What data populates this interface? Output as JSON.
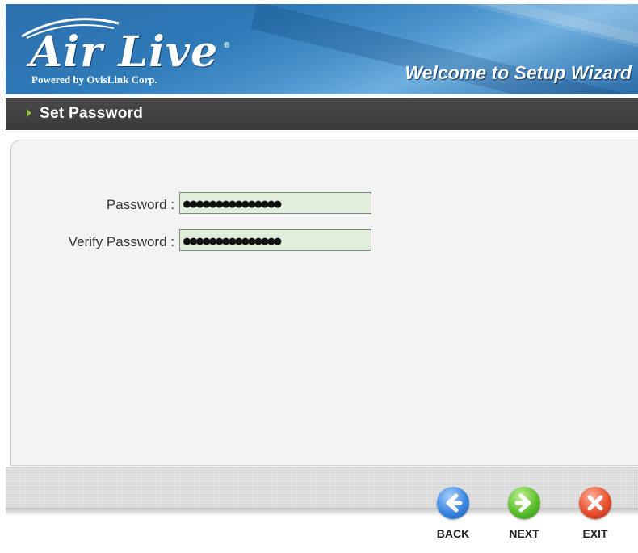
{
  "header": {
    "logo_text": "Air Live",
    "logo_registered": "®",
    "logo_subtitle": "Powered by OvisLink Corp.",
    "wizard_title": "Welcome to Setup Wizard"
  },
  "section": {
    "title": "Set Password"
  },
  "form": {
    "password_label": "Password :",
    "password_value": "●●●●●●●●●●●●●●●",
    "verify_label": "Verify Password :",
    "verify_value": "●●●●●●●●●●●●●●●"
  },
  "nav": {
    "back_label": "BACK",
    "next_label": "NEXT",
    "exit_label": "EXIT"
  },
  "colors": {
    "header_blue": "#2f7ab8",
    "section_bar": "#404040",
    "input_bg": "#e1eedb",
    "back_blue": "#3b86e0",
    "next_green": "#5bbf2c",
    "exit_red": "#e8502f"
  },
  "icons": {
    "section": "triangle-right-icon",
    "back": "arrow-left-icon",
    "next": "arrow-right-icon",
    "exit": "close-x-icon"
  }
}
